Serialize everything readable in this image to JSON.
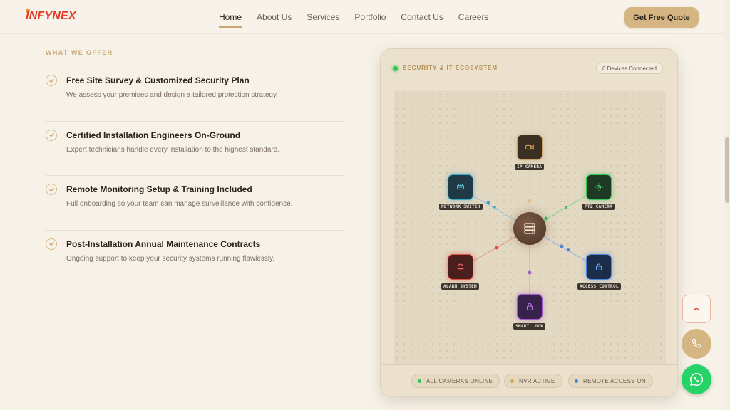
{
  "header": {
    "logo": "INFYNEX",
    "nav": [
      {
        "label": "Home",
        "active": true
      },
      {
        "label": "About Us"
      },
      {
        "label": "Services"
      },
      {
        "label": "Portfolio"
      },
      {
        "label": "Contact Us"
      },
      {
        "label": "Careers"
      }
    ],
    "cta_label": "Get Free Quote"
  },
  "offer_section": {
    "label": "WHAT WE OFFER",
    "items": [
      {
        "title": "Free Site Survey & Customized Security Plan",
        "desc": "We assess your premises and design a tailored protection strategy."
      },
      {
        "title": "Certified Installation Engineers On-Ground",
        "desc": "Expert technicians handle every installation to the highest standard."
      },
      {
        "title": "Remote Monitoring Setup & Training Included",
        "desc": "Full onboarding so your team can manage surveillance with confidence."
      },
      {
        "title": "Post-Installation Annual Maintenance Contracts",
        "desc": "Ongoing support to keep your security systems running flawlessly."
      }
    ]
  },
  "ecosystem": {
    "title": "SECURITY & IT ECOSYSTEM",
    "badge": "6 Devices Connected",
    "nodes": [
      {
        "label": "IP CAMERA",
        "icon": "video-camera-icon",
        "color": "#c9a56f"
      },
      {
        "label": "NETWORK SWITCH",
        "icon": "switch-icon",
        "color": "#3aa7c9"
      },
      {
        "label": "PTZ CAMERA",
        "icon": "ptz-camera-icon",
        "color": "#35c35a"
      },
      {
        "label": "ALARM SYSTEM",
        "icon": "bell-icon",
        "color": "#e05048"
      },
      {
        "label": "ACCESS CONTROL",
        "icon": "lock-icon",
        "color": "#4a86d8"
      },
      {
        "label": "SMART LOCK",
        "icon": "padlock-icon",
        "color": "#a35ad0"
      }
    ],
    "hub_icon": "server-icon",
    "status": [
      {
        "label": "ALL CAMERAS ONLINE",
        "color": "#35c35a"
      },
      {
        "label": "NVR ACTIVE",
        "color": "#d6a85a"
      },
      {
        "label": "REMOTE ACCESS ON",
        "color": "#4a86d8"
      }
    ]
  },
  "floating": {
    "up_icon": "chevron-up-icon",
    "phone_icon": "phone-icon",
    "whatsapp_icon": "whatsapp-icon"
  }
}
